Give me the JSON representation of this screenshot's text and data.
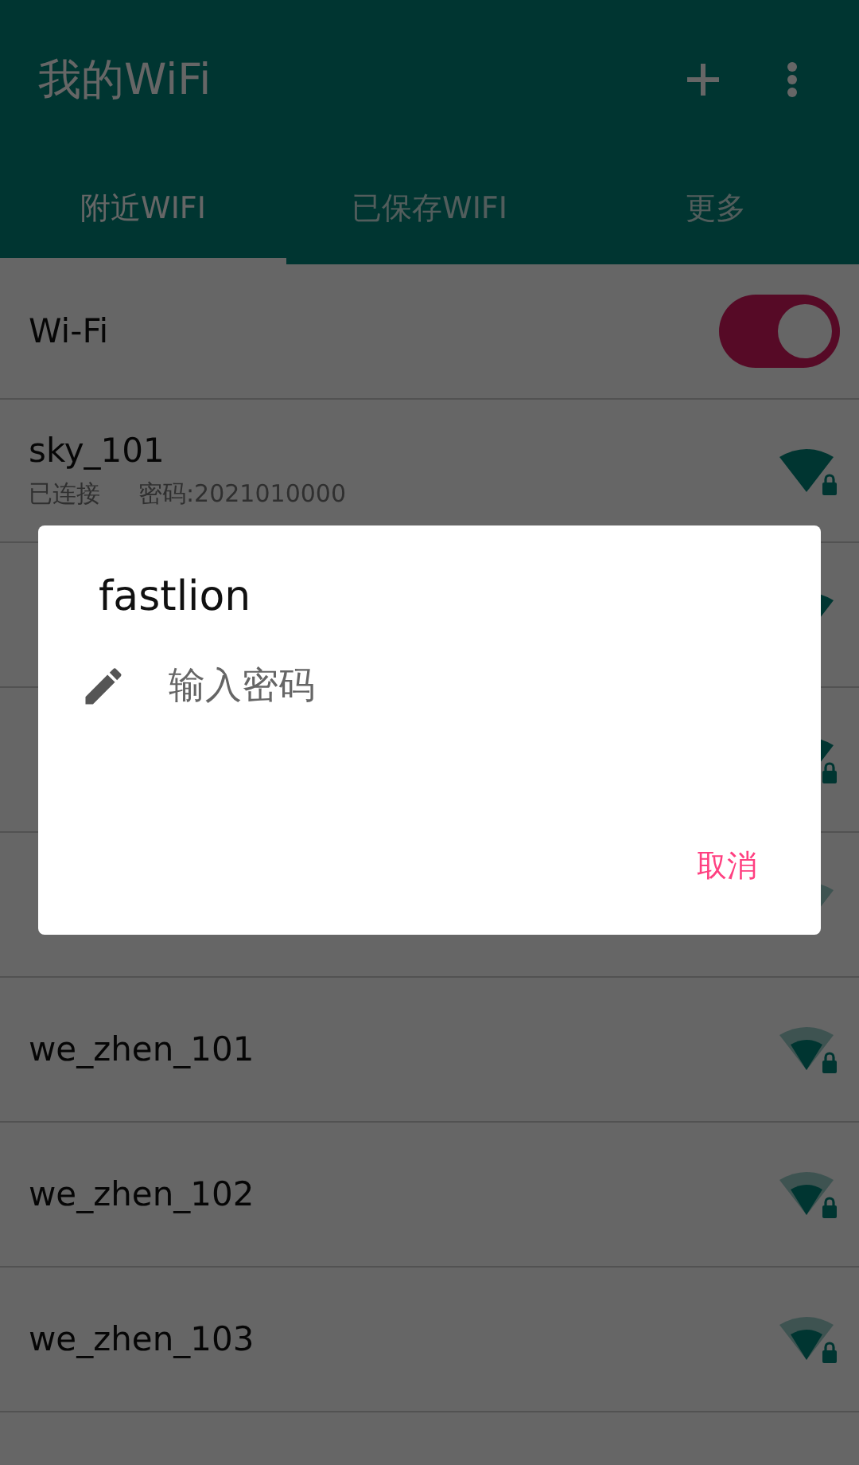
{
  "app_bar": {
    "title": "我的WiFi"
  },
  "tabs": [
    {
      "label": "附近WIFI",
      "selected": true
    },
    {
      "label": "已保存WIFI",
      "selected": false
    },
    {
      "label": "更多",
      "selected": false
    }
  ],
  "wifi_toggle": {
    "label": "Wi-Fi",
    "on": true
  },
  "networks": [
    {
      "name": "sky_101",
      "status": "已连接",
      "password": "密码:2021010000",
      "kind": "full",
      "secured": true
    },
    {
      "kind": "full",
      "secured": false
    },
    {
      "kind": "full",
      "secured": true
    },
    {
      "kind": "faint",
      "secured": false
    },
    {
      "name": "we_zhen_101",
      "kind": "medium",
      "secured": true
    },
    {
      "name": "we_zhen_102",
      "kind": "medium",
      "secured": true
    },
    {
      "name": "we_zhen_103",
      "kind": "medium",
      "secured": true
    }
  ],
  "dialog": {
    "title": "fastlion",
    "placeholder": "输入密码",
    "buttons": [
      "取消"
    ]
  }
}
